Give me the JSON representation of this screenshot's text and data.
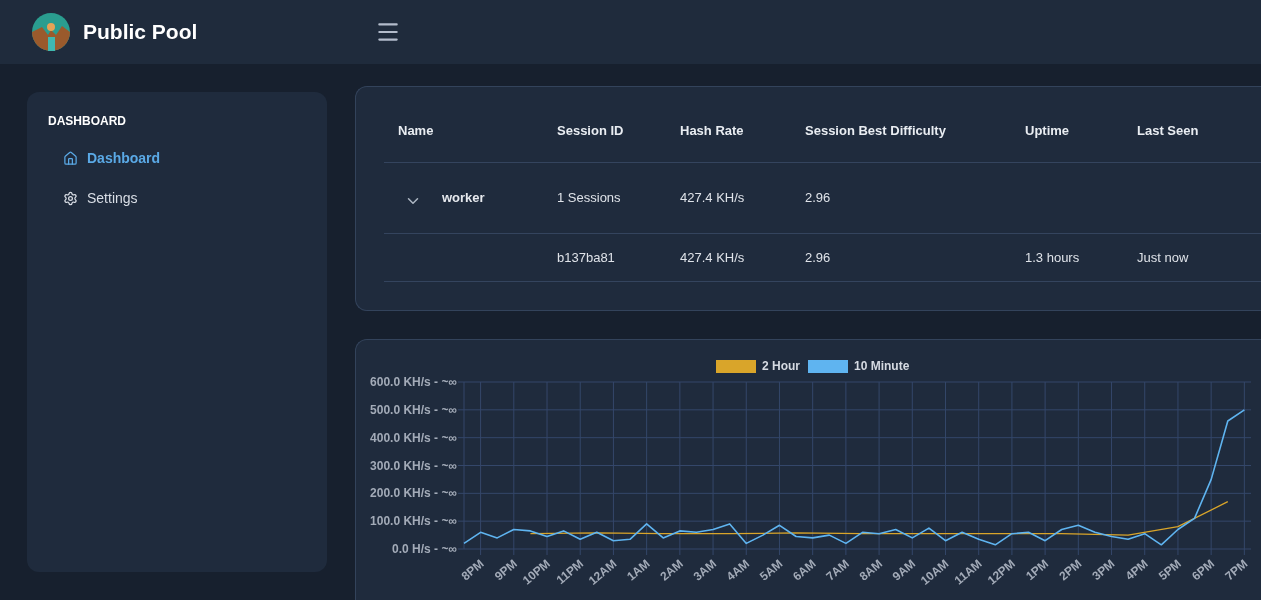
{
  "header": {
    "title": "Public Pool"
  },
  "sidebar": {
    "heading": "DASHBOARD",
    "items": [
      {
        "label": "Dashboard",
        "selected": true
      },
      {
        "label": "Settings",
        "selected": false
      }
    ]
  },
  "table": {
    "columns": [
      "Name",
      "Session ID",
      "Hash Rate",
      "Session Best Difficulty",
      "Uptime",
      "Last Seen"
    ],
    "rows": [
      {
        "kind": "worker",
        "expanded": true,
        "cells": [
          "worker",
          "1 Sessions",
          "427.4 KH/s",
          "2.96",
          "",
          ""
        ]
      },
      {
        "kind": "session",
        "cells": [
          "",
          "b137ba81",
          "427.4 KH/s",
          "2.96",
          "1.3 hours",
          "Just now"
        ]
      }
    ]
  },
  "chart": {
    "chart_data": {
      "type": "line",
      "grid": true,
      "legend": "top",
      "ylim": [
        0,
        600
      ],
      "categories": [
        null,
        "8PM",
        null,
        "9PM",
        null,
        "10PM",
        null,
        "11PM",
        null,
        "12AM",
        null,
        "1AM",
        null,
        "2AM",
        null,
        "3AM",
        null,
        "4AM",
        null,
        "5AM",
        null,
        "6AM",
        null,
        "7AM",
        null,
        "8AM",
        null,
        "9AM",
        null,
        "10AM",
        null,
        "11AM",
        null,
        "12PM",
        null,
        "1PM",
        null,
        "2PM",
        null,
        "3PM",
        null,
        "4PM",
        null,
        "5PM",
        null,
        "6PM",
        null,
        "7PM"
      ],
      "yticks": [
        {
          "value": 0,
          "label": "0.0 H/s - ~∞"
        },
        {
          "value": 100,
          "label": "100.0 KH/s - ~∞"
        },
        {
          "value": 200,
          "label": "200.0 KH/s - ~∞"
        },
        {
          "value": 300,
          "label": "300.0 KH/s - ~∞"
        },
        {
          "value": 400,
          "label": "400.0 KH/s - ~∞"
        },
        {
          "value": 500,
          "label": "500.0 KH/s - ~∞"
        },
        {
          "value": 600,
          "label": "600.0 KH/s - ~∞"
        }
      ],
      "series": [
        {
          "name": "2 Hour",
          "color": "#d9a52a",
          "values": [
            null,
            null,
            null,
            null,
            55,
            null,
            null,
            null,
            58,
            null,
            null,
            null,
            55,
            null,
            null,
            null,
            55,
            null,
            null,
            null,
            58,
            null,
            null,
            null,
            55,
            null,
            null,
            null,
            55,
            null,
            null,
            null,
            55,
            null,
            null,
            null,
            55,
            null,
            null,
            null,
            50,
            null,
            null,
            80,
            null,
            null,
            170,
            null
          ]
        },
        {
          "name": "10 Minute",
          "color": "#5fb4f0",
          "values": [
            20,
            60,
            40,
            70,
            65,
            45,
            65,
            35,
            60,
            30,
            35,
            90,
            40,
            65,
            60,
            70,
            90,
            20,
            50,
            85,
            45,
            40,
            50,
            20,
            60,
            55,
            70,
            40,
            75,
            30,
            60,
            35,
            15,
            55,
            60,
            30,
            70,
            85,
            60,
            45,
            35,
            55,
            15,
            70,
            110,
            250,
            460,
            500
          ]
        }
      ]
    }
  }
}
